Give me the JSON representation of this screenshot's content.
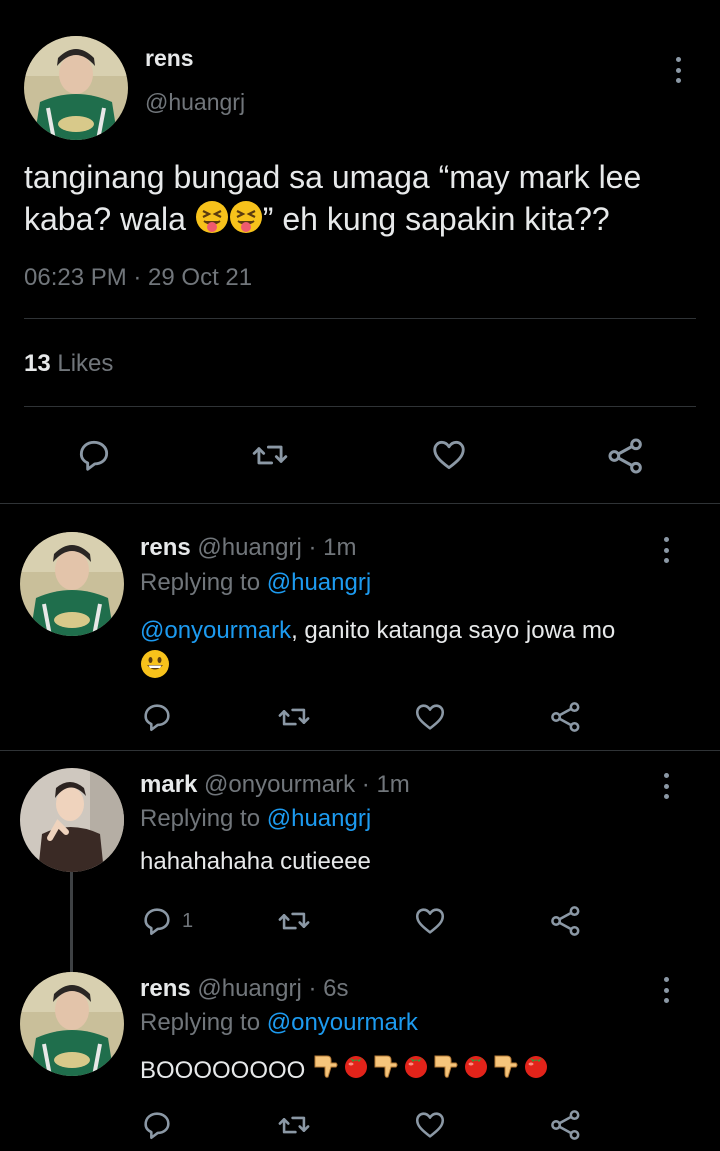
{
  "main_tweet": {
    "display_name": "rens",
    "handle": "@huangrj",
    "text_line1": "tanginang bungad sa umaga “may mark lee",
    "text_line2_a": "kaba? wala",
    "text_line2_b": "” eh kung sapakin kita??",
    "emoji": "squinting-face-with-tongue",
    "timestamp": "06:23 PM · 29 Oct 21",
    "likes_count": "13",
    "likes_label": "Likes"
  },
  "replies": [
    {
      "display_name": "rens",
      "handle": "@huangrj",
      "time": "· 1m",
      "replying_label": "Replying to",
      "replying_to": "@huangrj",
      "mention": "@onyourmark",
      "text": ", ganito katanga sayo jowa mo",
      "emoji": "grinning-face"
    },
    {
      "display_name": "mark",
      "handle": "@onyourmark",
      "time": "· 1m",
      "replying_label": "Replying to",
      "replying_to": "@huangrj",
      "text": "hahahahaha cutieeee",
      "reply_count": "1"
    },
    {
      "display_name": "rens",
      "handle": "@huangrj",
      "time": "· 6s",
      "replying_label": "Replying to",
      "replying_to": "@onyourmark",
      "text": "BOOOOOOOO",
      "emoji_sequence": [
        "thumbs-down",
        "tomato",
        "thumbs-down",
        "tomato",
        "thumbs-down",
        "tomato",
        "thumbs-down",
        "tomato"
      ]
    }
  ],
  "colors": {
    "background": "#000000",
    "text": "#e7e9ea",
    "secondary": "#71767b",
    "link": "#1d9bf0",
    "divider": "#2f3336"
  }
}
